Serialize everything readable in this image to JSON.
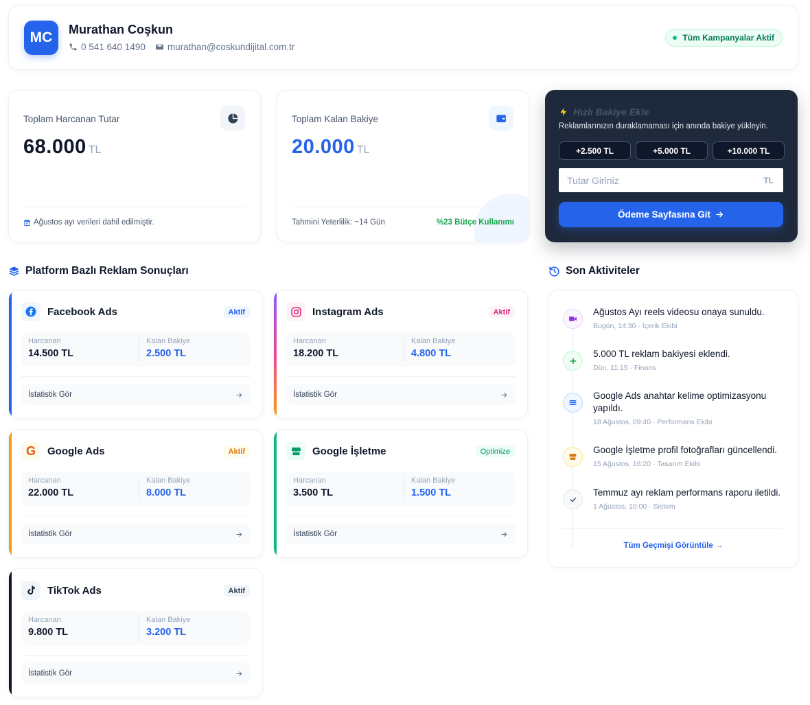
{
  "header": {
    "initials": "MC",
    "name": "Murathan Coşkun",
    "phone": "0 541 640 1490",
    "email": "murathan@coskundijital.com.tr",
    "status": "Tüm Kampanyalar Aktif"
  },
  "stats": {
    "spent": {
      "label": "Toplam Harcanan Tutar",
      "value": "68.000",
      "unit": "TL",
      "footnote": "Ağustos ayı verileri dahil edilmiştir."
    },
    "balance": {
      "label": "Toplam Kalan Bakiye",
      "value": "20.000",
      "unit": "TL",
      "footnote": "Tahmini Yeterlilik: ~14 Gün",
      "usage": "%23 Bütçe Kullanımı"
    }
  },
  "quick_topup": {
    "title": "Hızlı Bakiye Ekle",
    "subtitle": "Reklamlarınızın duraklamaması için anında bakiye yükleyin.",
    "amounts": [
      "+2.500 TL",
      "+5.000 TL",
      "+10.000 TL"
    ],
    "input_placeholder": "Tutar Giriniz",
    "currency": "TL",
    "pay_button": "Ödeme Sayfasına Git"
  },
  "platforms_section": {
    "title": "Platform Bazlı Reklam Sonuçları"
  },
  "labels": {
    "spent": "Harcanan",
    "remaining": "Kalan Bakiye",
    "stats_link": "İstatistik Gör"
  },
  "platforms": [
    {
      "name": "Facebook Ads",
      "badge": "Aktif",
      "spent": "14.500 TL",
      "remaining": "2.500 TL",
      "accent": "#2563eb",
      "icon": "facebook-icon"
    },
    {
      "name": "Instagram Ads",
      "badge": "Aktif",
      "spent": "18.200 TL",
      "remaining": "4.800 TL",
      "accent": "#db2777",
      "icon": "instagram-icon"
    },
    {
      "name": "Google Ads",
      "badge": "Aktif",
      "spent": "22.000 TL",
      "remaining": "8.000 TL",
      "accent": "#f59e0b",
      "icon": "google-icon"
    },
    {
      "name": "Google İşletme",
      "badge": "Optimize",
      "spent": "3.500 TL",
      "remaining": "1.500 TL",
      "accent": "#10b981",
      "icon": "store-icon"
    },
    {
      "name": "TikTok Ads",
      "badge": "Aktif",
      "spent": "9.800 TL",
      "remaining": "3.200 TL",
      "accent": "#0f172a",
      "icon": "tiktok-icon"
    }
  ],
  "activities_section": {
    "title": "Son Aktiviteler"
  },
  "activities": [
    {
      "text": "Ağustos Ayı reels videosu onaya sunuldu.",
      "meta": "Bugün, 14:30 · İçerik Ekibi",
      "icon": "video-icon"
    },
    {
      "text": "5.000 TL reklam bakiyesi eklendi.",
      "meta": "Dün, 11:15 · Finans",
      "icon": "plus-icon"
    },
    {
      "text": "Google Ads anahtar kelime optimizasyonu yapıldı.",
      "meta": "18 Ağustos, 09:40 · Performans Ekibi",
      "icon": "sliders-icon"
    },
    {
      "text": "Google İşletme profil fotoğrafları güncellendi.",
      "meta": "15 Ağustos, 16:20 · Tasarım Ekibi",
      "icon": "store-icon"
    },
    {
      "text": "Temmuz ayı reklam performans raporu iletildi.",
      "meta": "1 Ağustos, 10:00 · Sistem",
      "icon": "check-icon"
    }
  ],
  "activities_link": "Tüm Geçmişi Görüntüle →"
}
